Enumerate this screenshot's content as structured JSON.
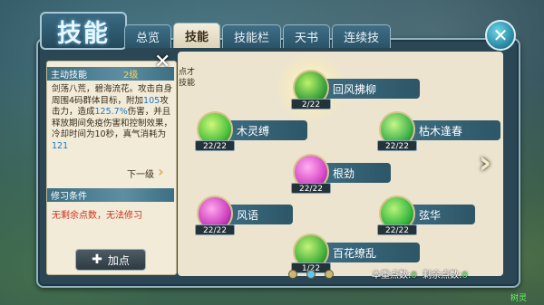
{
  "title": "技能",
  "tabs": [
    {
      "label": "总览",
      "active": false
    },
    {
      "label": "技能",
      "active": true
    },
    {
      "label": "技能栏",
      "active": false
    },
    {
      "label": "天书",
      "active": false
    },
    {
      "label": "连续技",
      "active": false
    }
  ],
  "info": {
    "header": "主动技能",
    "level": "2级",
    "description_parts": [
      "剑荡八荒，碧海流花。攻击自身周围4码群体目标，附加",
      "105",
      "攻击力，造成",
      "125.7%",
      "伤害，并且释放期间免疫伤害和控制效果，冷却时间为",
      "10秒",
      "，真气消耗为",
      "121"
    ],
    "next_level": "下一级",
    "condition_header": "修习条件",
    "condition_text": "无剩余点数，无法修习",
    "add_button": "加点"
  },
  "partial_text": "点才\n技能",
  "skills": [
    {
      "name": "回风拂柳",
      "count": "2/22",
      "color": "#3aa43a",
      "selected": true
    },
    {
      "name": "木灵缚",
      "count": "22/22",
      "color": "#4cc23c",
      "selected": false
    },
    {
      "name": "枯木逢春",
      "count": "22/22",
      "color": "#3fb44a",
      "selected": false
    },
    {
      "name": "根劲",
      "count": "22/22",
      "color": "#d84ac8",
      "selected": false
    },
    {
      "name": "风语",
      "count": "22/22",
      "color": "#cc3fbf",
      "selected": false
    },
    {
      "name": "弦华",
      "count": "22/22",
      "color": "#37b83f",
      "selected": false
    },
    {
      "name": "百花缭乱",
      "count": "1/22",
      "color": "#44b23a",
      "selected": false
    }
  ],
  "points": {
    "label_total": "本重点数:",
    "total": "0",
    "label_remaining": "剩余点数",
    "remaining": "0"
  },
  "watermark": "树灵"
}
